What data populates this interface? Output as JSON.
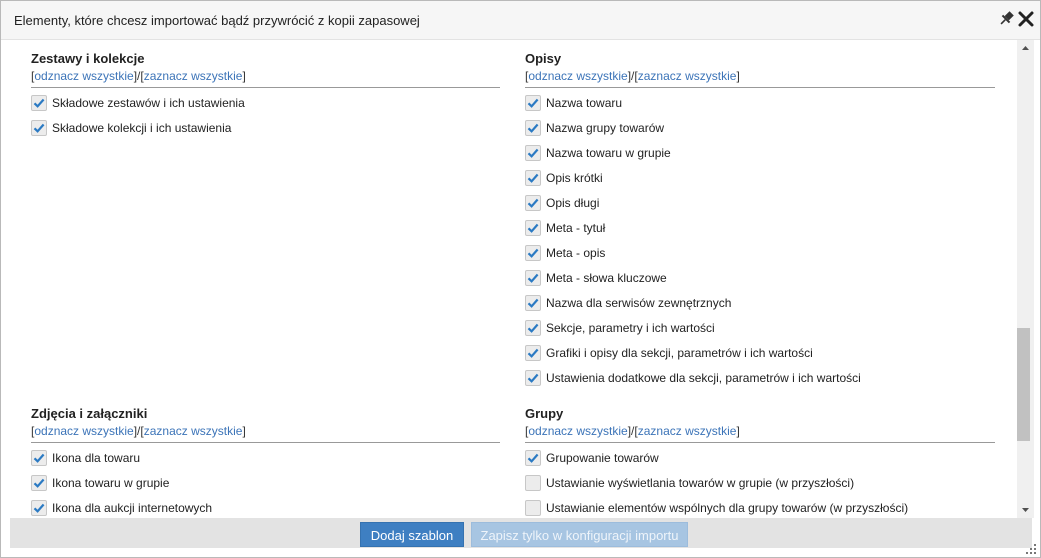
{
  "window": {
    "title": "Elementy, które chcesz importować bądź przywrócić z kopii zapasowej"
  },
  "sections": [
    {
      "title": "Zestawy i kolekcje",
      "deselect_all": "odznacz wszystkie",
      "select_all": "zaznacz wszystkie",
      "items": [
        {
          "label": "Składowe zestawów i ich ustawienia",
          "checked": true
        },
        {
          "label": "Składowe kolekcji i ich ustawienia",
          "checked": true
        }
      ]
    },
    {
      "title": "Opisy",
      "deselect_all": "odznacz wszystkie",
      "select_all": "zaznacz wszystkie",
      "items": [
        {
          "label": "Nazwa towaru",
          "checked": true
        },
        {
          "label": "Nazwa grupy towarów",
          "checked": true
        },
        {
          "label": "Nazwa towaru w grupie",
          "checked": true
        },
        {
          "label": "Opis krótki",
          "checked": true
        },
        {
          "label": "Opis długi",
          "checked": true
        },
        {
          "label": "Meta - tytuł",
          "checked": true
        },
        {
          "label": "Meta - opis",
          "checked": true
        },
        {
          "label": "Meta - słowa kluczowe",
          "checked": true
        },
        {
          "label": "Nazwa dla serwisów zewnętrznych",
          "checked": true
        },
        {
          "label": "Sekcje, parametry i ich wartości",
          "checked": true
        },
        {
          "label": "Grafiki i opisy dla sekcji, parametrów i ich wartości",
          "checked": true
        },
        {
          "label": "Ustawienia dodatkowe dla sekcji, parametrów i ich wartości",
          "checked": true
        }
      ]
    },
    {
      "title": "Zdjęcia i załączniki",
      "deselect_all": "odznacz wszystkie",
      "select_all": "zaznacz wszystkie",
      "items": [
        {
          "label": "Ikona dla towaru",
          "checked": true
        },
        {
          "label": "Ikona towaru w grupie",
          "checked": true
        },
        {
          "label": "Ikona dla aukcji internetowych",
          "checked": true
        }
      ]
    },
    {
      "title": "Grupy",
      "deselect_all": "odznacz wszystkie",
      "select_all": "zaznacz wszystkie",
      "items": [
        {
          "label": "Grupowanie towarów",
          "checked": true
        },
        {
          "label": "Ustawianie wyświetlania towarów w grupie (w przyszłości)",
          "checked": false
        },
        {
          "label": "Ustawianie elementów wspólnych dla grupy towarów (w przyszłości)",
          "checked": false
        }
      ]
    }
  ],
  "footer": {
    "add_template": "Dodaj szablon",
    "save_config_only": "Zapisz tylko w konfiguracji importu"
  },
  "icons": {
    "pin": "pin-icon",
    "close": "close-icon",
    "checkmark": "checkmark-icon",
    "scroll_up": "chevron-up-icon",
    "scroll_down": "chevron-down-icon",
    "resize": "resize-grip-icon"
  },
  "colors": {
    "link": "#3c74b8",
    "check": "#2b7ac3",
    "primary_button": "#3e7fc2",
    "disabled_button": "#a7c5e2"
  }
}
